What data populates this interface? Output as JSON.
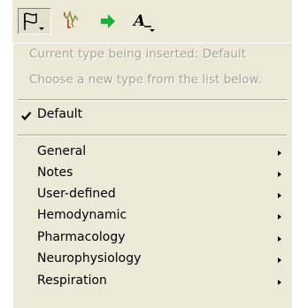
{
  "toolbar": {
    "buttons": [
      {
        "name": "flag-annotation-icon",
        "pressed": true,
        "has_dropdown": true
      },
      {
        "name": "waveform-marker-icon",
        "pressed": false,
        "has_dropdown": false
      },
      {
        "name": "green-arrow-icon",
        "pressed": false,
        "has_dropdown": false
      },
      {
        "name": "text-style-icon",
        "pressed": false,
        "has_dropdown": true
      }
    ]
  },
  "menu": {
    "info_line_1": "Current type being inserted: Default",
    "info_line_2": "Choose a new type from the list below.",
    "checked_item": {
      "label": "Default",
      "checked": true
    },
    "items": [
      {
        "label": "General",
        "has_submenu": true
      },
      {
        "label": "Notes",
        "has_submenu": true
      },
      {
        "label": "User-defined",
        "has_submenu": true
      },
      {
        "label": "Hemodynamic",
        "has_submenu": true
      },
      {
        "label": "Pharmacology",
        "has_submenu": true
      },
      {
        "label": "Neurophysiology",
        "has_submenu": true
      },
      {
        "label": "Respiration",
        "has_submenu": true
      }
    ]
  },
  "colors": {
    "menu_background": "#ece9d8",
    "disabled_text": "#a7a496",
    "icon_green": "#1fae3a",
    "icon_red": "#c0282b",
    "icon_olive": "#8a8a2a"
  }
}
